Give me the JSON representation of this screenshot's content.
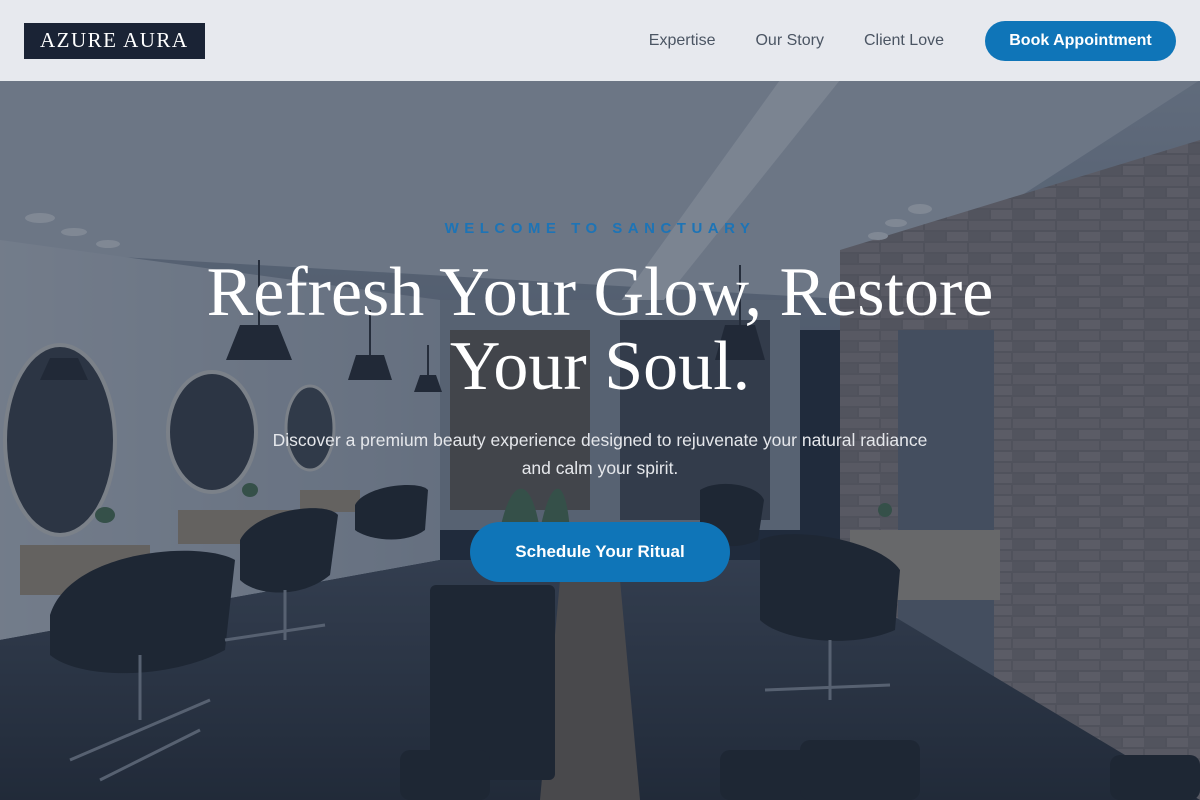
{
  "brand": {
    "logo_text": "AZURE AURA"
  },
  "nav": {
    "links": [
      "Expertise",
      "Our Story",
      "Client Love"
    ],
    "book_label": "Book Appointment"
  },
  "hero": {
    "eyebrow": "WELCOME TO SANCTUARY",
    "headline": "Refresh Your Glow, Restore Your Soul.",
    "subtext": "Discover a premium beauty experience designed to rejuvenate your natural radiance and calm your spirit.",
    "cta_label": "Schedule Your Ritual",
    "background": "salon-interior-photo"
  },
  "colors": {
    "accent": "#0f75b8",
    "logo_bg": "#1a2335",
    "nav_bg": "#eceef2",
    "eyebrow": "#1d74b6",
    "nav_text": "#4b5563"
  }
}
